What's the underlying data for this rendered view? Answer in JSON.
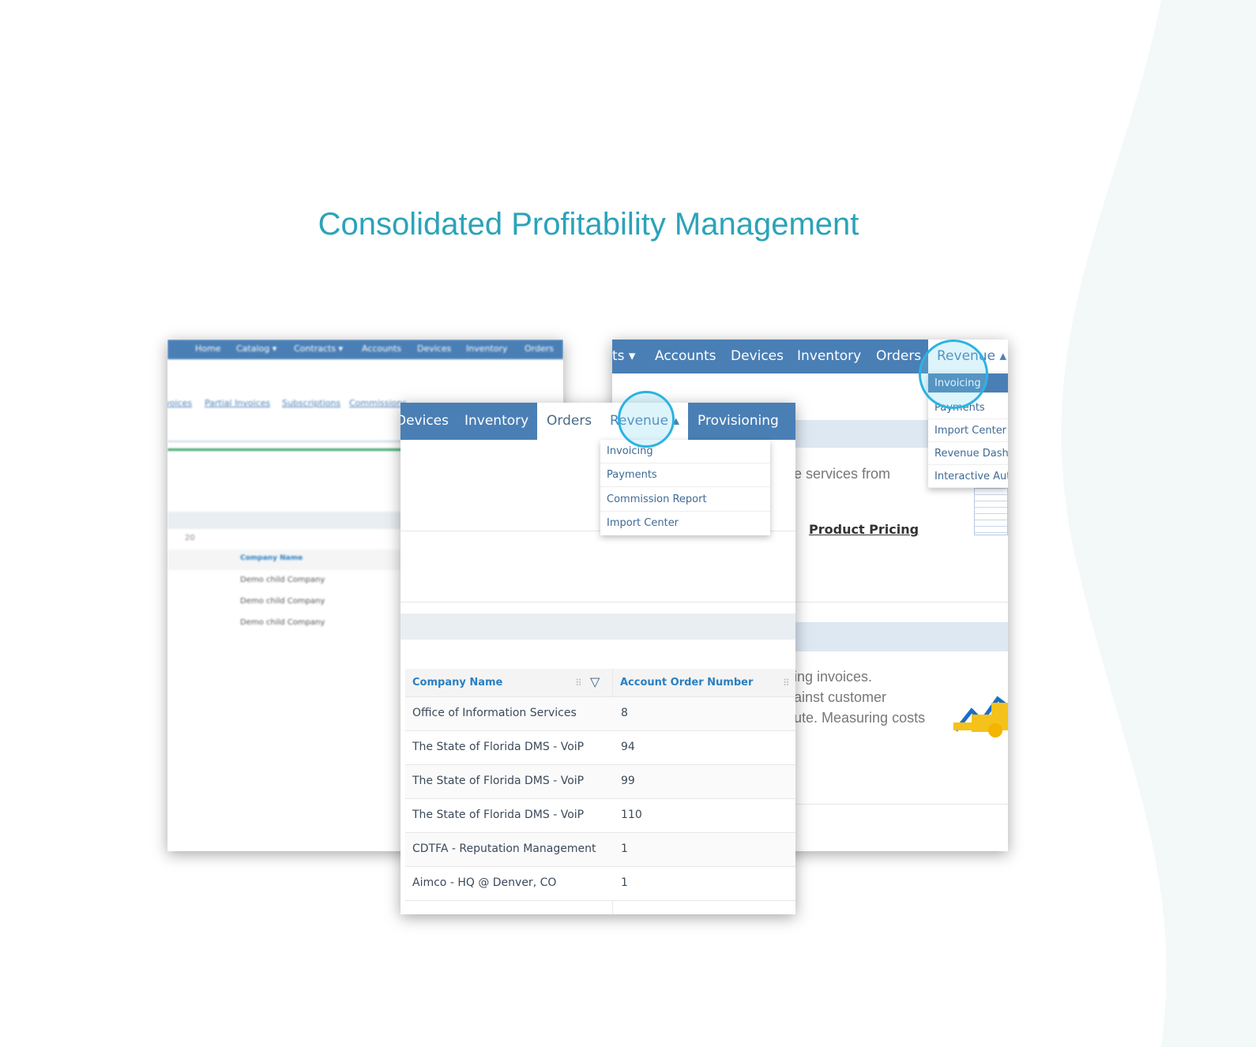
{
  "title": "Consolidated Profitability Management",
  "colors": {
    "accent": "#2ba3b9",
    "nav": "#4a7fb5",
    "highlight": "#2bb3e3"
  },
  "back_left": {
    "nav": [
      "Home",
      "Catalog ▾",
      "Contracts ▾",
      "Accounts",
      "Devices",
      "Inventory",
      "Orders"
    ],
    "links": [
      "Invoices",
      "Partial Invoices",
      "Subscriptions",
      "Commissions"
    ],
    "page_size": "20",
    "headers": [
      "Company Name"
    ],
    "rows": [
      "Demo child Company",
      "Demo child Company",
      "Demo child Company"
    ]
  },
  "back_right": {
    "nav": [
      "ts ▾",
      "Accounts",
      "Devices",
      "Inventory",
      "Orders"
    ],
    "active_menu": "Revenue ▴",
    "dropdown": [
      "Invoicing",
      "Payments",
      "Import Center",
      "Revenue Dashb",
      "Interactive Aut"
    ],
    "text1": "e services from",
    "link": "Product Pricing",
    "text2": [
      "ing invoices.",
      "ainst customer",
      "ute. Measuring costs"
    ]
  },
  "front": {
    "nav": [
      "Devices",
      "Inventory"
    ],
    "active_tab": "Orders",
    "revenue_menu": "Revenue ▴",
    "provisioning": "Provisioning",
    "dropdown": [
      "Invoicing",
      "Payments",
      "Commission Report",
      "Import Center"
    ],
    "table": {
      "headers": [
        "Company Name",
        "Account Order Number"
      ],
      "rows": [
        [
          "Office of Information Services",
          "8"
        ],
        [
          "The State of Florida DMS - VoiP",
          "94"
        ],
        [
          "The State of Florida DMS - VoiP",
          "99"
        ],
        [
          "The State of Florida DMS - VoiP",
          "110"
        ],
        [
          "CDTFA - Reputation Management",
          "1"
        ],
        [
          "Aimco - HQ @ Denver, CO",
          "1"
        ]
      ]
    }
  }
}
